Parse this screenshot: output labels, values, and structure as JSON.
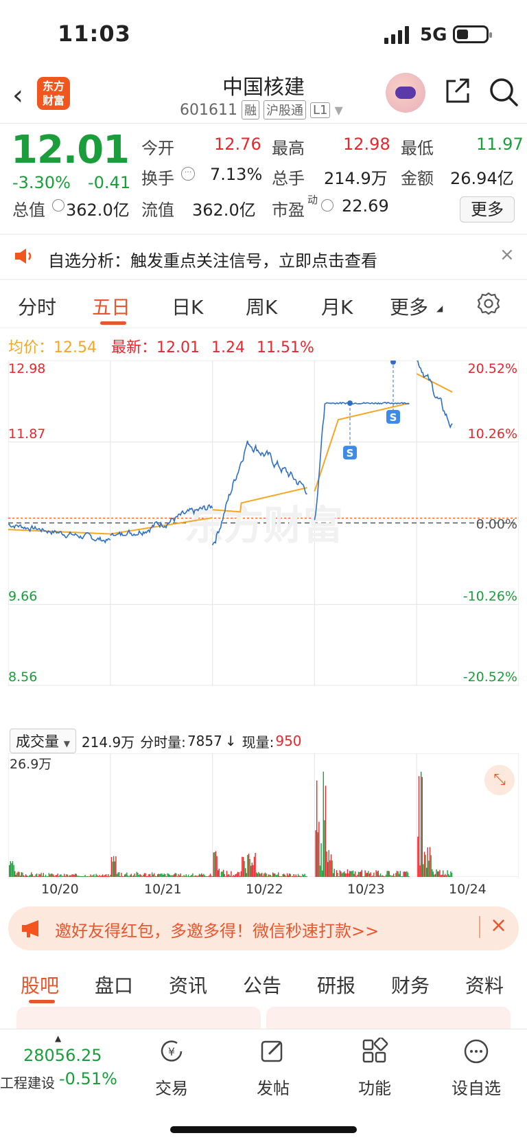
{
  "status": {
    "time": "11:03",
    "network": "5G"
  },
  "header": {
    "name": "中国核建",
    "code": "601611",
    "tags": [
      "融",
      "沪股通",
      "L1"
    ],
    "logo_line1": "东方",
    "logo_line2": "财富"
  },
  "quote": {
    "price": "12.01",
    "chg_pct": "-3.30%",
    "chg": "-0.41",
    "open_label": "今开",
    "open": "12.76",
    "high_label": "最高",
    "high": "12.98",
    "low_label": "最低",
    "low": "11.97",
    "turnover_label": "换手",
    "turnover": "7.13%",
    "vol_label": "总手",
    "vol": "214.9万",
    "amount_label": "金额",
    "amount": "26.94亿",
    "mcap_label": "总值",
    "mcap": "362.0亿",
    "float_label": "流值",
    "float": "362.0亿",
    "pe_label": "市盈",
    "pe_sup": "动",
    "pe": "22.69",
    "more": "更多"
  },
  "banner": {
    "text": "自选分析：触发重点关注信号，立即点击查看"
  },
  "tabs": [
    "分时",
    "五日",
    "日K",
    "周K",
    "月K",
    "更多"
  ],
  "avg": {
    "avg_label": "均价：",
    "avg": "12.54",
    "latest_label": "最新：",
    "latest": "12.01",
    "chg": "1.24",
    "pct": "11.51%"
  },
  "chart_data": {
    "type": "line",
    "x": [
      "10/20",
      "10/21",
      "10/22",
      "10/23",
      "10/24"
    ],
    "y_left": [
      "12.98",
      "11.87",
      "9.66",
      "8.56"
    ],
    "y_right": [
      "20.52%",
      "10.26%",
      "0.00%",
      "-10.26%",
      "-20.52%"
    ],
    "ylim": [
      8.56,
      12.98
    ],
    "prev_close": 10.77,
    "series": [
      {
        "values": [
          10.75,
          10.55,
          11.12,
          10.35,
          11.9,
          10.95,
          12.4,
          12.98,
          12.01
        ]
      },
      {
        "values": [
          10.68,
          10.62,
          10.85,
          10.82,
          11.25,
          11.06,
          12.0,
          12.1,
          12.8,
          12.54
        ]
      }
    ],
    "watermark": "东方财富"
  },
  "volume": {
    "select": "成交量",
    "total": "214.9万",
    "min_label": "分时量:",
    "min_val": "7857",
    "arrow": "↓",
    "now_label": "现量:",
    "now_val": "950",
    "ymax": "26.9万"
  },
  "invite": {
    "text": "邀好友得红包，多邀多得！微信秒速打款>>"
  },
  "bottom_tabs": [
    "股吧",
    "盘口",
    "资讯",
    "公告",
    "研报",
    "财务",
    "资料"
  ],
  "index": {
    "value": "28056.25",
    "name": "工程建设",
    "pct": "-0.51%"
  },
  "bottom_bar": [
    "交易",
    "发帖",
    "功能",
    "设自选"
  ],
  "colors": {
    "up": "#e8262d",
    "down": "#1a9d3a",
    "accent": "#e8562d",
    "line": "#2e6fc5",
    "avg": "#f5a623"
  }
}
